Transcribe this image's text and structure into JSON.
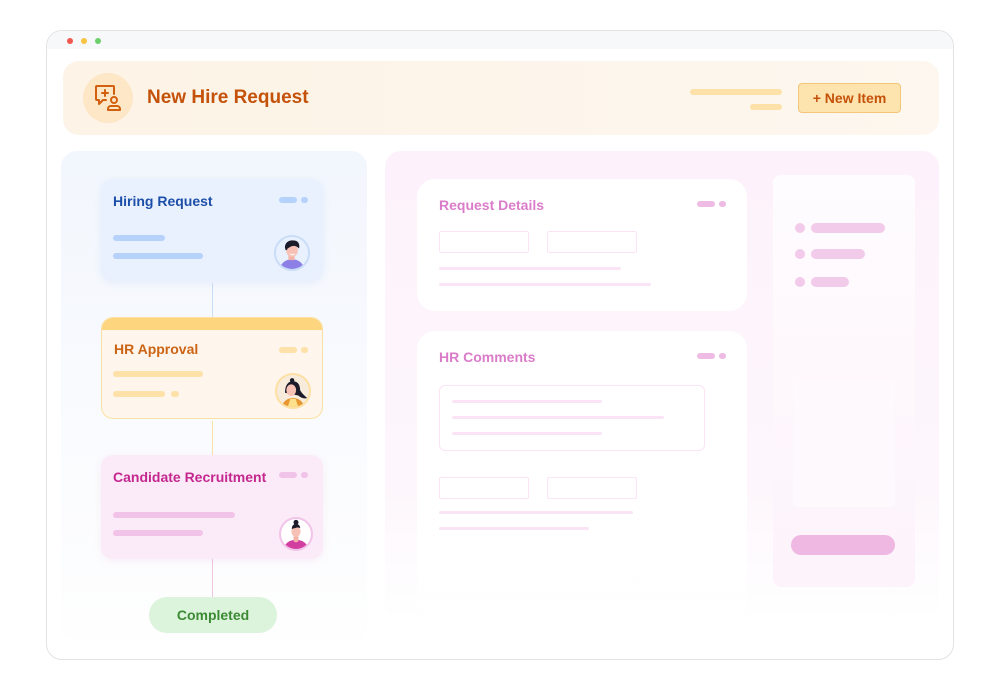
{
  "window": {
    "controls": [
      "close",
      "minimize",
      "maximize"
    ]
  },
  "header": {
    "icon": "chat-add-user-icon",
    "title": "New Hire Request",
    "new_item_button": "+ New Item"
  },
  "workflow": {
    "steps": [
      {
        "title": "Hiring Request",
        "color": "#1c4fa8",
        "avatar": "male-avatar-purple-hoodie"
      },
      {
        "title": "HR Approval",
        "color": "#cc6414",
        "avatar": "female-avatar-orange-jacket",
        "active": true
      },
      {
        "title": "Candidate Recruitment",
        "color": "#c4288f",
        "avatar": "female-avatar-magenta-top"
      }
    ],
    "completed_label": "Completed"
  },
  "form": {
    "request_details": {
      "title": "Request Details"
    },
    "hr_comments": {
      "title": "HR Comments"
    }
  },
  "colors": {
    "accent_orange": "#c4520a",
    "blue": "#1c4fa8",
    "pink": "#db7cc9",
    "green": "#3c8a34"
  }
}
